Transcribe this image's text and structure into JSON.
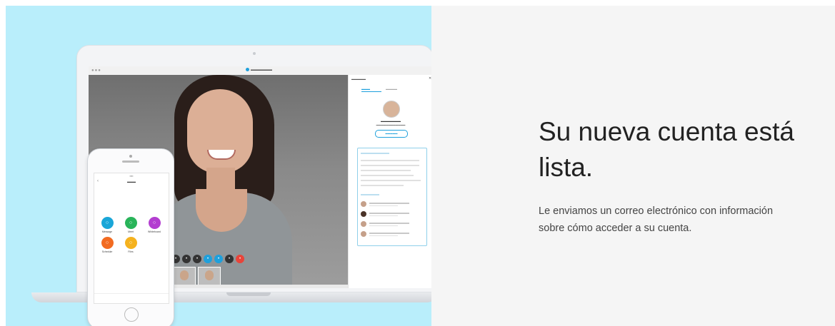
{
  "hero": {
    "headline": "Su nueva cuenta está lista.",
    "body": "Le enviamos un correo electrónico con información sobre cómo acceder a su cuenta."
  },
  "colors": {
    "left_panel_bg": "#b9eefb",
    "right_panel_bg": "#f5f5f5",
    "accent": "#1ea0dc"
  },
  "phone": {
    "apps": [
      {
        "label": "Message",
        "color": "#1aa6d8",
        "icon": "chat-icon"
      },
      {
        "label": "Meet",
        "color": "#29b45a",
        "icon": "video-icon"
      },
      {
        "label": "Whiteboard",
        "color": "#b33ed0",
        "icon": "pencil-icon"
      },
      {
        "label": "Schedule",
        "color": "#f26b21",
        "icon": "calendar-icon"
      },
      {
        "label": "Files",
        "color": "#f5b21e",
        "icon": "folder-icon"
      }
    ]
  },
  "meeting": {
    "controls": [
      "#333333",
      "#333333",
      "#333333",
      "#1ea0dc",
      "#1ea0dc",
      "#333333",
      "#e8443a"
    ]
  }
}
